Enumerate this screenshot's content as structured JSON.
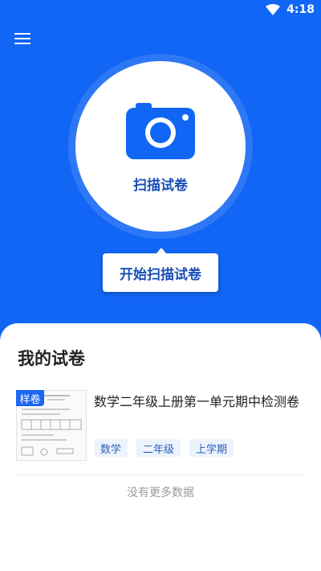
{
  "status_bar": {
    "time": "4:18"
  },
  "hero": {
    "scan_label": "扫描试卷",
    "start_button": "开始扫描试卷"
  },
  "my_papers": {
    "title": "我的试卷",
    "items": [
      {
        "badge": "样卷",
        "title": "数学二年级上册第一单元期中检测卷",
        "tags": [
          "数学",
          "二年级",
          "上学期"
        ]
      }
    ],
    "empty_text": "没有更多数据"
  },
  "colors": {
    "primary": "#1166f5",
    "primary_dark": "#1a4fb7",
    "tag_bg": "#edf3fd"
  },
  "icons": [
    "wifi-icon",
    "menu-icon",
    "camera-icon"
  ]
}
